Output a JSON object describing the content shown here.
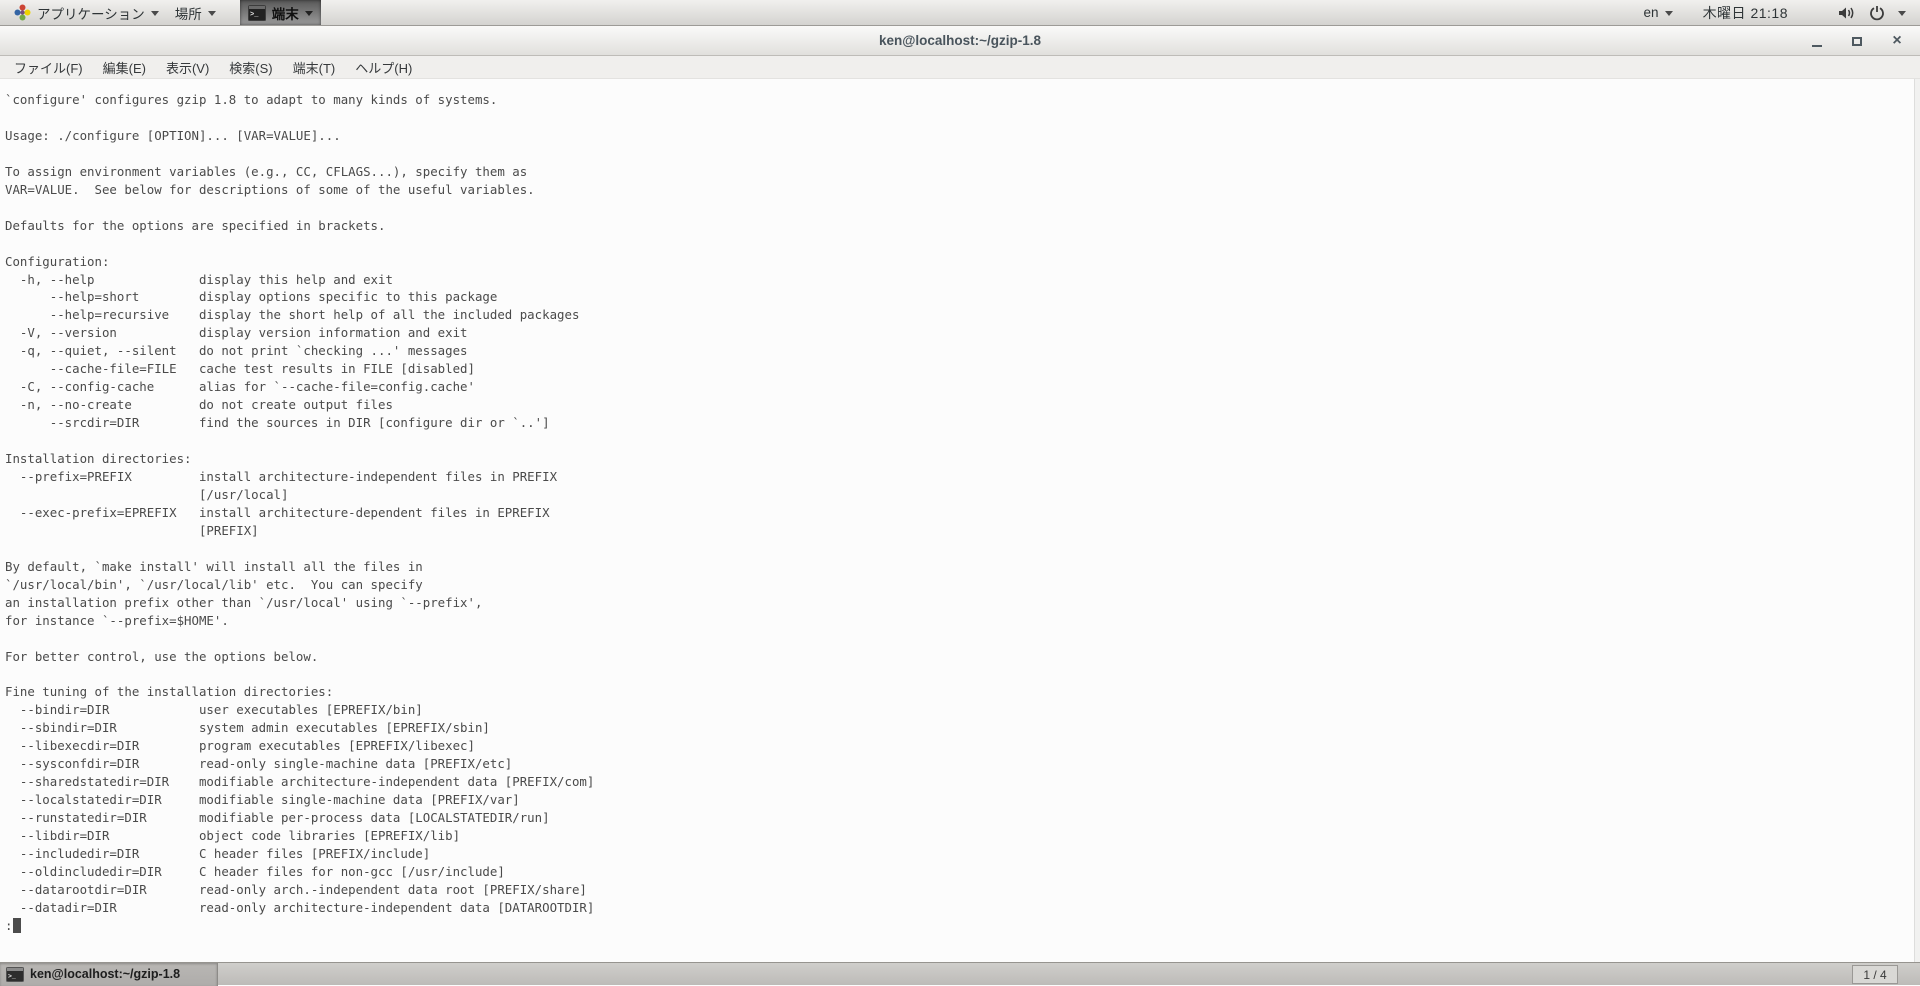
{
  "top_panel": {
    "applications_label": "アプリケーション",
    "places_label": "場所",
    "active_app_label": "端末",
    "keyboard_layout": "en",
    "clock": "木曜日 21:18"
  },
  "window": {
    "title": "ken@localhost:~/gzip-1.8"
  },
  "menubar": {
    "items": [
      "ファイル(F)",
      "編集(E)",
      "表示(V)",
      "検索(S)",
      "端末(T)",
      "ヘルプ(H)"
    ]
  },
  "terminal": {
    "lines": [
      "`configure' configures gzip 1.8 to adapt to many kinds of systems.",
      "",
      "Usage: ./configure [OPTION]... [VAR=VALUE]...",
      "",
      "To assign environment variables (e.g., CC, CFLAGS...), specify them as",
      "VAR=VALUE.  See below for descriptions of some of the useful variables.",
      "",
      "Defaults for the options are specified in brackets.",
      "",
      "Configuration:",
      "  -h, --help              display this help and exit",
      "      --help=short        display options specific to this package",
      "      --help=recursive    display the short help of all the included packages",
      "  -V, --version           display version information and exit",
      "  -q, --quiet, --silent   do not print `checking ...' messages",
      "      --cache-file=FILE   cache test results in FILE [disabled]",
      "  -C, --config-cache      alias for `--cache-file=config.cache'",
      "  -n, --no-create         do not create output files",
      "      --srcdir=DIR        find the sources in DIR [configure dir or `..']",
      "",
      "Installation directories:",
      "  --prefix=PREFIX         install architecture-independent files in PREFIX",
      "                          [/usr/local]",
      "  --exec-prefix=EPREFIX   install architecture-dependent files in EPREFIX",
      "                          [PREFIX]",
      "",
      "By default, `make install' will install all the files in",
      "`/usr/local/bin', `/usr/local/lib' etc.  You can specify",
      "an installation prefix other than `/usr/local' using `--prefix',",
      "for instance `--prefix=$HOME'.",
      "",
      "For better control, use the options below.",
      "",
      "Fine tuning of the installation directories:",
      "  --bindir=DIR            user executables [EPREFIX/bin]",
      "  --sbindir=DIR           system admin executables [EPREFIX/sbin]",
      "  --libexecdir=DIR        program executables [EPREFIX/libexec]",
      "  --sysconfdir=DIR        read-only single-machine data [PREFIX/etc]",
      "  --sharedstatedir=DIR    modifiable architecture-independent data [PREFIX/com]",
      "  --localstatedir=DIR     modifiable single-machine data [PREFIX/var]",
      "  --runstatedir=DIR       modifiable per-process data [LOCALSTATEDIR/run]",
      "  --libdir=DIR            object code libraries [EPREFIX/lib]",
      "  --includedir=DIR        C header files [PREFIX/include]",
      "  --oldincludedir=DIR     C header files for non-gcc [/usr/include]",
      "  --datarootdir=DIR       read-only arch.-independent data root [PREFIX/share]",
      "  --datadir=DIR           read-only architecture-independent data [DATAROOTDIR]"
    ],
    "pager_prompt": ":"
  },
  "bottom_panel": {
    "task_label": "ken@localhost:~/gzip-1.8",
    "workspace_indicator": "1 / 4"
  },
  "icons": {
    "close": "×"
  },
  "colors": {
    "terminal_fg": "#4a4a4a",
    "terminal_bg": "#fcfcfc",
    "panel_text": "#2e3436",
    "title_text": "#49545c"
  }
}
